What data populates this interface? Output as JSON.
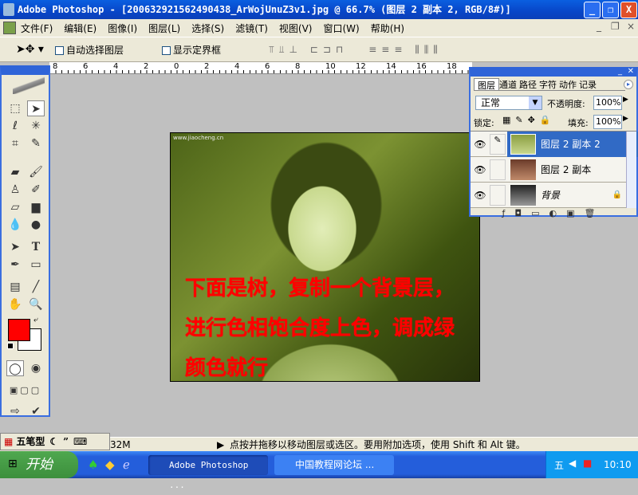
{
  "window": {
    "title": "Adobe Photoshop - [200632921562490438_ArWojUnuZ3v1.jpg @ 66.7% (图层 2 副本 2, RGB/8#)]",
    "controls": [
      "_",
      "❐",
      "X"
    ]
  },
  "menu": {
    "items": [
      "文件(F)",
      "编辑(E)",
      "图像(I)",
      "图层(L)",
      "选择(S)",
      "滤镜(T)",
      "视图(V)",
      "窗口(W)",
      "帮助(H)"
    ]
  },
  "options": {
    "auto_select": "自动选择图层",
    "show_bounds": "显示定界框",
    "auto_select_checked": false,
    "show_bounds_checked": false
  },
  "ruler": {
    "ticks": [
      "8",
      "6",
      "4",
      "2",
      "0",
      "2",
      "4",
      "6",
      "8",
      "10",
      "12",
      "14",
      "16",
      "18"
    ]
  },
  "toolbox": {
    "foreground_color": "#ff0000",
    "background_color": "#ffffff"
  },
  "canvas": {
    "watermark": "www.jiaocheng.cn",
    "annotation_lines": [
      "下面是树，复制一个背景层，",
      "进行色相饱合度上色，调成绿",
      "颜色就行"
    ]
  },
  "layers_panel": {
    "tabs": [
      "图层",
      "通道",
      "路径",
      "字符",
      "动作",
      "记录"
    ],
    "blend_mode": "正常",
    "opacity_label": "不透明度:",
    "opacity": "100%",
    "lock_label": "锁定:",
    "fill_label": "填充:",
    "fill": "100%",
    "layers": [
      {
        "name": "图层 2 副本 2",
        "selected": true
      },
      {
        "name": "图层 2 副本",
        "selected": false
      },
      {
        "name": "背景",
        "selected": false,
        "locked": true
      }
    ]
  },
  "statusbar": {
    "ime": "五笔型",
    "doc_size": "32M",
    "hint": "点按并拖移以移动图层或选区。要用附加选项，使用 Shift 和 Alt 键。"
  },
  "taskbar": {
    "start": "开始",
    "tasks": [
      "Adobe Photoshop ...",
      "中国教程网论坛 ..."
    ],
    "clock": "10:10"
  }
}
